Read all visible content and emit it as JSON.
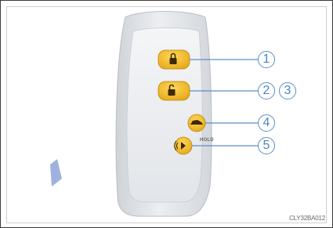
{
  "callouts": [
    "1",
    "2",
    "3",
    "4",
    "5"
  ],
  "hold_label": "HOLD",
  "figure_code": "CLY32BA012",
  "colors": {
    "callout_blue": "#4b86c1",
    "button_yellow": "#f0b21a",
    "key_body": "#e7e9ec"
  },
  "icons": [
    "lock-icon",
    "unlock-icon",
    "trunk-icon",
    "panic-icon"
  ]
}
